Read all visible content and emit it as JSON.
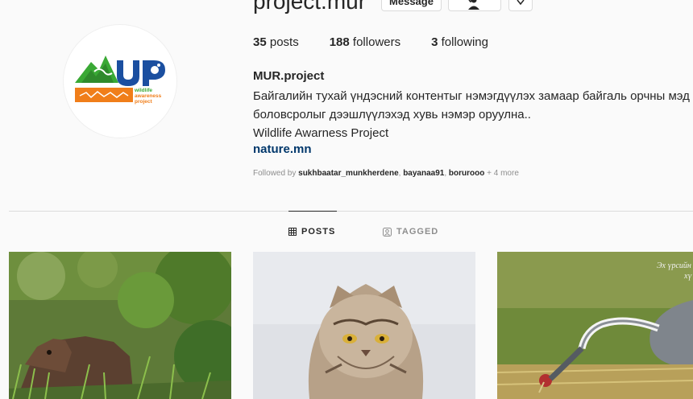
{
  "profile": {
    "username": "project.mur",
    "actions": {
      "message_label": "Message"
    },
    "stats": {
      "posts_count": "35",
      "posts_label": "posts",
      "followers_count": "188",
      "followers_label": "followers",
      "following_count": "3",
      "following_label": "following"
    },
    "name": "MUR.project",
    "bio_lines": [
      "Байгалийн тухай үндэсний контентыг нэмэгдүүлэх замаар байгаль орчны мэд",
      "боловсролыг дээшлүүлэхэд хувь нэмэр оруулна..",
      "Wildlife Awarness Project"
    ],
    "website": "nature.mn",
    "followed_by": {
      "prefix": "Followed by",
      "users": [
        "sukhbaatar_munkherdene",
        "bayanaa91",
        "borurooо"
      ],
      "more": "+ 4 more"
    }
  },
  "logo_text": {
    "letters": "MUR",
    "sub": [
      "wildlife",
      "awareness",
      "project"
    ]
  },
  "tabs": [
    {
      "label": "POSTS",
      "active": true,
      "icon": "grid-icon"
    },
    {
      "label": "TAGGED",
      "active": false,
      "icon": "tag-icon"
    }
  ],
  "posts": [
    {
      "subject": "wild boar in green grass"
    },
    {
      "subject": "pallas cat on snow"
    },
    {
      "subject": "white-naped crane feeding",
      "caption_lines": [
        "Эх үрсийн",
        "хү"
      ]
    }
  ],
  "colors": {
    "link": "#00376b",
    "muted": "#8e8e8e",
    "text": "#262626",
    "logo_green": "#3aa935",
    "logo_blue": "#1b4fa0",
    "logo_orange": "#f07e1a"
  }
}
